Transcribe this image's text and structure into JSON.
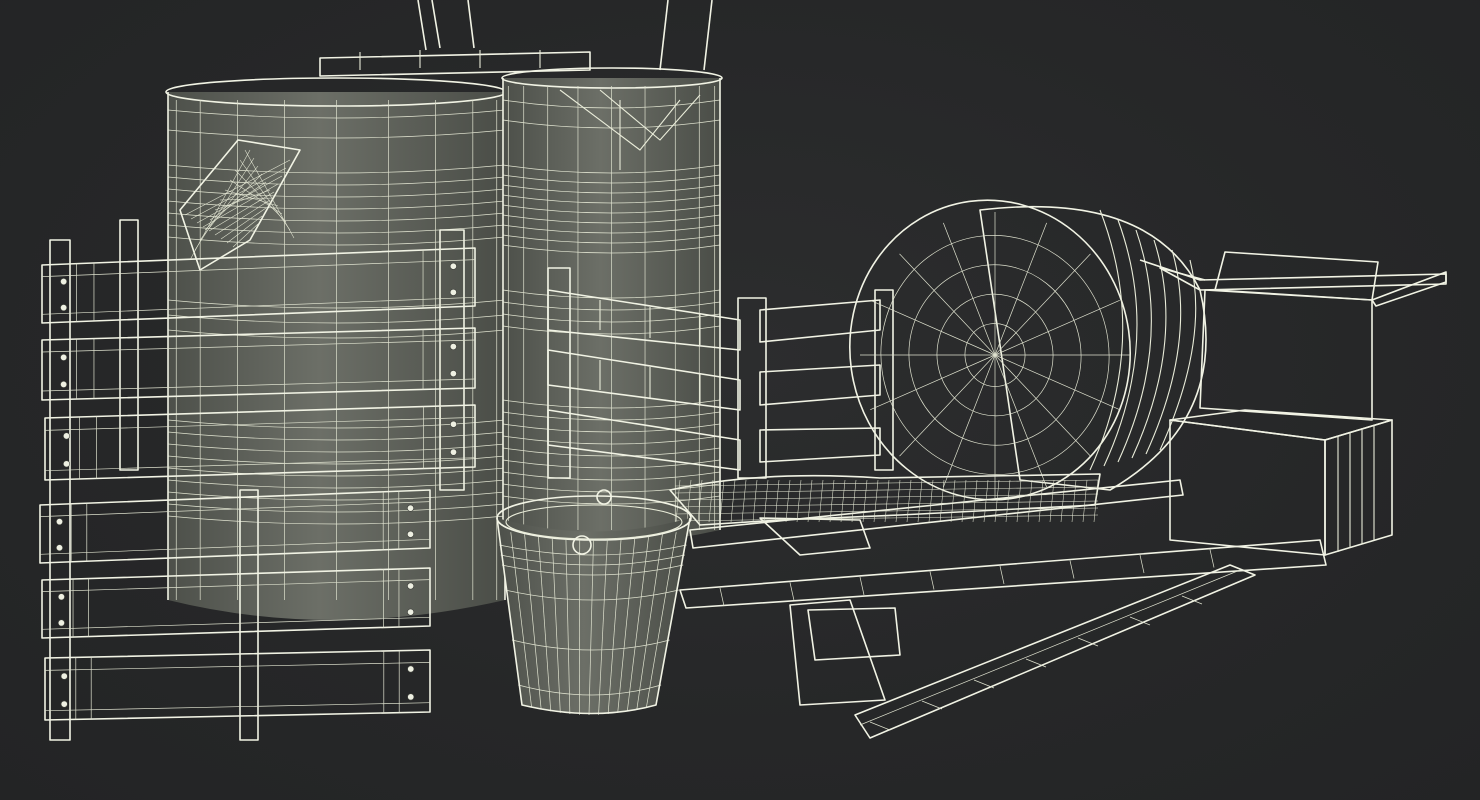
{
  "scene": {
    "kind": "wireframe-render",
    "background_color": "#262728",
    "wire_color": "#e9ecd9",
    "surface_color": "#5f625b",
    "objects": [
      "wooden-crate-stack",
      "metal-barrel-rear",
      "metal-barrel-front",
      "wooden-barrel-lying",
      "broken-wooden-crate",
      "metal-bucket",
      "cardboard-box-open",
      "cardboard-box-closed",
      "loose-planks",
      "sack-cloth"
    ]
  }
}
